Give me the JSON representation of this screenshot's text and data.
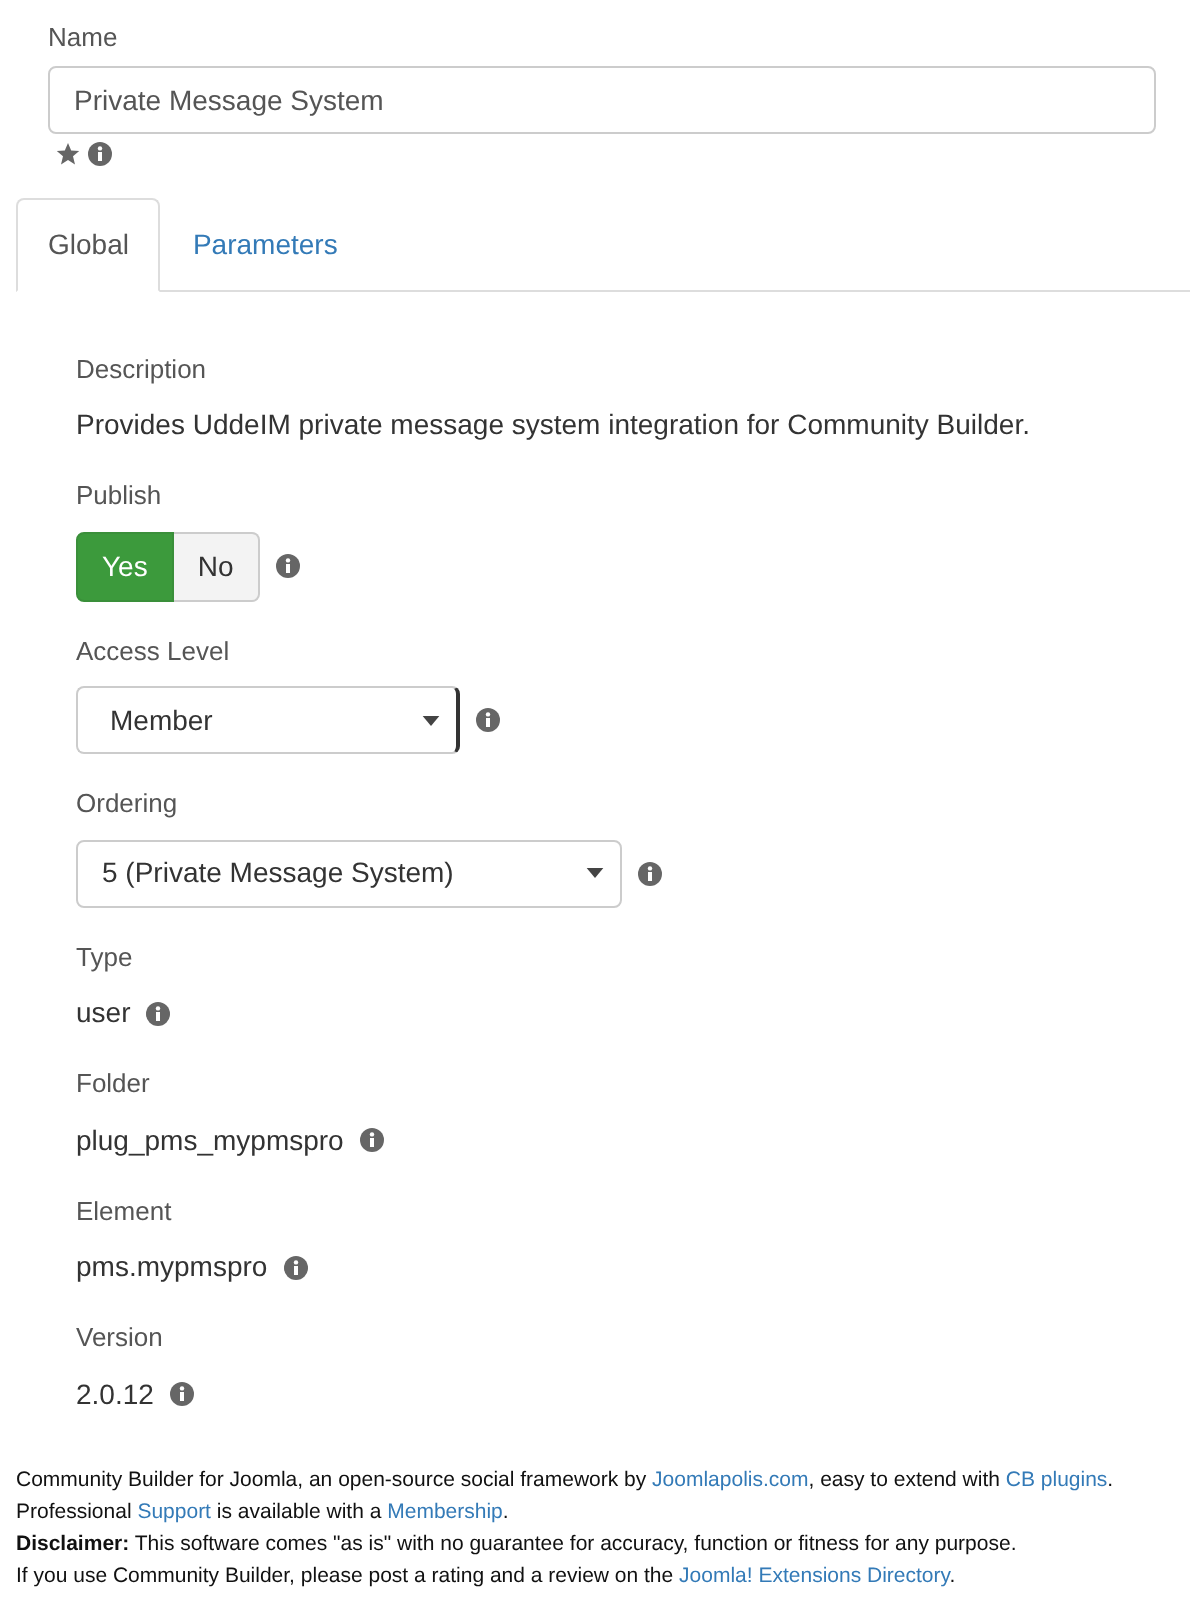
{
  "name_field": {
    "label": "Name",
    "value": "Private Message System"
  },
  "tabs": [
    {
      "label": "Global",
      "selected": true
    },
    {
      "label": "Parameters",
      "selected": false
    }
  ],
  "fields": [
    {
      "kind": "text",
      "label": "Description",
      "value": "Provides UddeIM private message system integration for Community Builder."
    },
    {
      "kind": "toggle",
      "label": "Publish",
      "options": [
        {
          "label": "Yes",
          "selected": true
        },
        {
          "label": "No",
          "selected": false
        }
      ]
    },
    {
      "kind": "select",
      "label": "Access Level",
      "value": "Member"
    },
    {
      "kind": "select",
      "label": "Ordering",
      "value": "5 (Private Message System)"
    },
    {
      "kind": "info",
      "label": "Type",
      "value": "user"
    },
    {
      "kind": "info",
      "label": "Folder",
      "value": "plug_pms_mypmspro"
    },
    {
      "kind": "info",
      "label": "Element",
      "value": "pms.mypmspro"
    },
    {
      "kind": "info",
      "label": "Version",
      "value": "2.0.12"
    }
  ],
  "footer": [
    [
      {
        "kind": "text",
        "text": "Community Builder for Joomla, an open-source social framework by "
      },
      {
        "kind": "link",
        "text": "Joomlapolis.com"
      },
      {
        "kind": "text",
        "text": ", easy to extend with "
      },
      {
        "kind": "link",
        "text": "CB plugins"
      },
      {
        "kind": "text",
        "text": "."
      }
    ],
    [
      {
        "kind": "text",
        "text": "Professional "
      },
      {
        "kind": "link",
        "text": "Support"
      },
      {
        "kind": "text",
        "text": " is available with a "
      },
      {
        "kind": "link",
        "text": "Membership"
      },
      {
        "kind": "text",
        "text": "."
      }
    ],
    [
      {
        "kind": "text",
        "text": "**Disclaimer:** This software comes \"as is\" with no guarantee for accuracy, function or fitness for any purpose."
      }
    ],
    [
      {
        "kind": "text",
        "text": "If you use Community Builder, please post a rating and a review on the "
      },
      {
        "kind": "link",
        "text": "Joomla! Extensions Directory"
      },
      {
        "kind": "text",
        "text": "."
      }
    ]
  ]
}
